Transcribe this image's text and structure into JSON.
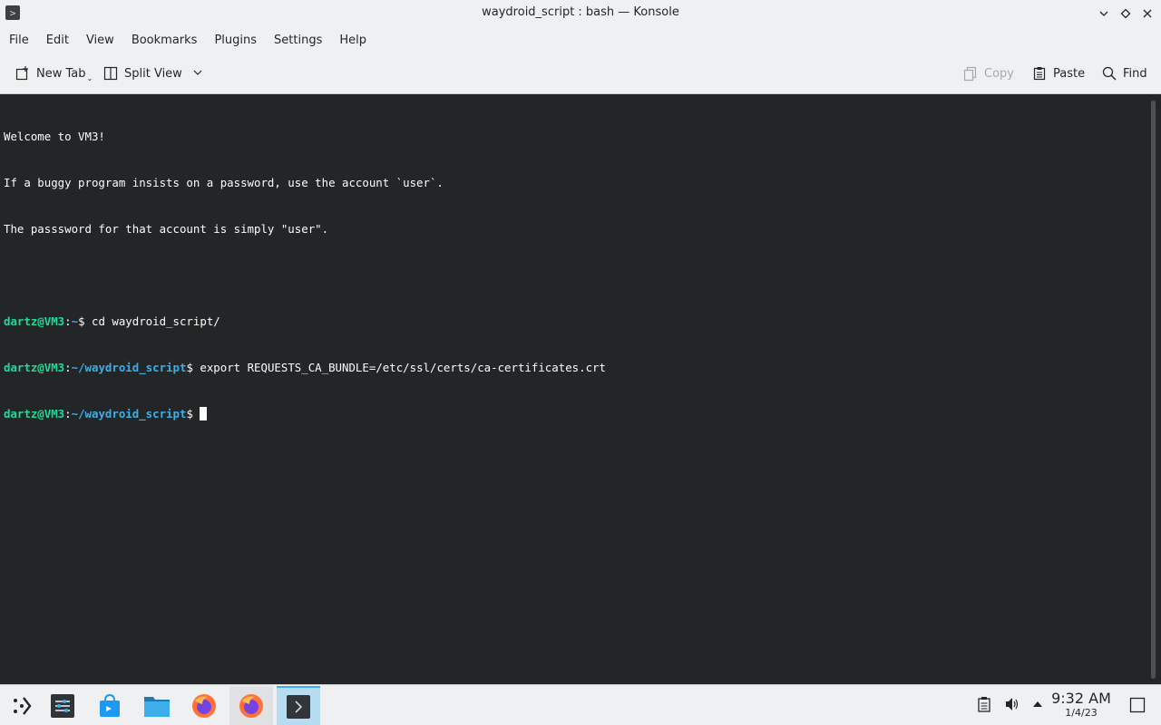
{
  "window": {
    "title": "waydroid_script : bash — Konsole",
    "app_icon": "terminal-icon",
    "controls": [
      "minimize-icon",
      "maximize-icon",
      "close-icon"
    ]
  },
  "menubar": {
    "items": [
      "File",
      "Edit",
      "View",
      "Bookmarks",
      "Plugins",
      "Settings",
      "Help"
    ]
  },
  "toolbar": {
    "new_tab_label": "New Tab",
    "split_view_label": "Split View",
    "copy_label": "Copy",
    "paste_label": "Paste",
    "find_label": "Find"
  },
  "terminal": {
    "welcome_lines": [
      "Welcome to VM3!",
      "If a buggy program insists on a password, use the account `user`.",
      "The passsword for that account is simply \"user\"."
    ],
    "user_host": "dartz@VM3",
    "commands": [
      {
        "path": "~",
        "command": "cd waydroid_script/"
      },
      {
        "path": "~/waydroid_script",
        "command": "export REQUESTS_CA_BUNDLE=/etc/ssl/certs/ca-certificates.crt"
      },
      {
        "path": "~/waydroid_script",
        "command": ""
      }
    ],
    "colors": {
      "background": "#232627",
      "user": "#1cdc9a",
      "path": "#3daee9",
      "text": "#fcfcfc"
    }
  },
  "taskbar": {
    "apps": [
      "application-launcher-icon",
      "system-settings-icon",
      "discover-icon",
      "file-manager-icon",
      "firefox-icon",
      "firefox-icon",
      "konsole-icon"
    ],
    "tray": [
      "clipboard-icon",
      "volume-icon",
      "tray-expand-icon"
    ],
    "time": "9:32 AM",
    "date": "1/4/23",
    "show_desktop": "show-desktop-icon"
  }
}
